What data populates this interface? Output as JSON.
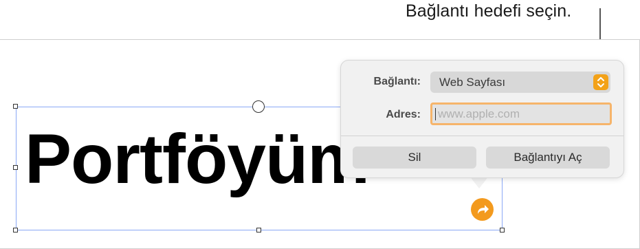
{
  "callout": {
    "text": "Bağlantı hedefi seçin."
  },
  "canvas": {
    "textbox_text": "Portföyüm"
  },
  "popover": {
    "link_label": "Bağlantı:",
    "link_type_value": "Web Sayfası",
    "address_label": "Adres:",
    "address_placeholder": "www.apple.com",
    "address_value": "",
    "remove_button": "Sil",
    "open_link_button": "Bağlantıyı Aç"
  },
  "colors": {
    "accent": "#f39a1e",
    "selection": "#8aa8f5",
    "focus_ring": "#f6b46a"
  },
  "icons": {
    "link_badge": "curved-arrow-icon",
    "stepper": "chevron-up-down-icon"
  }
}
